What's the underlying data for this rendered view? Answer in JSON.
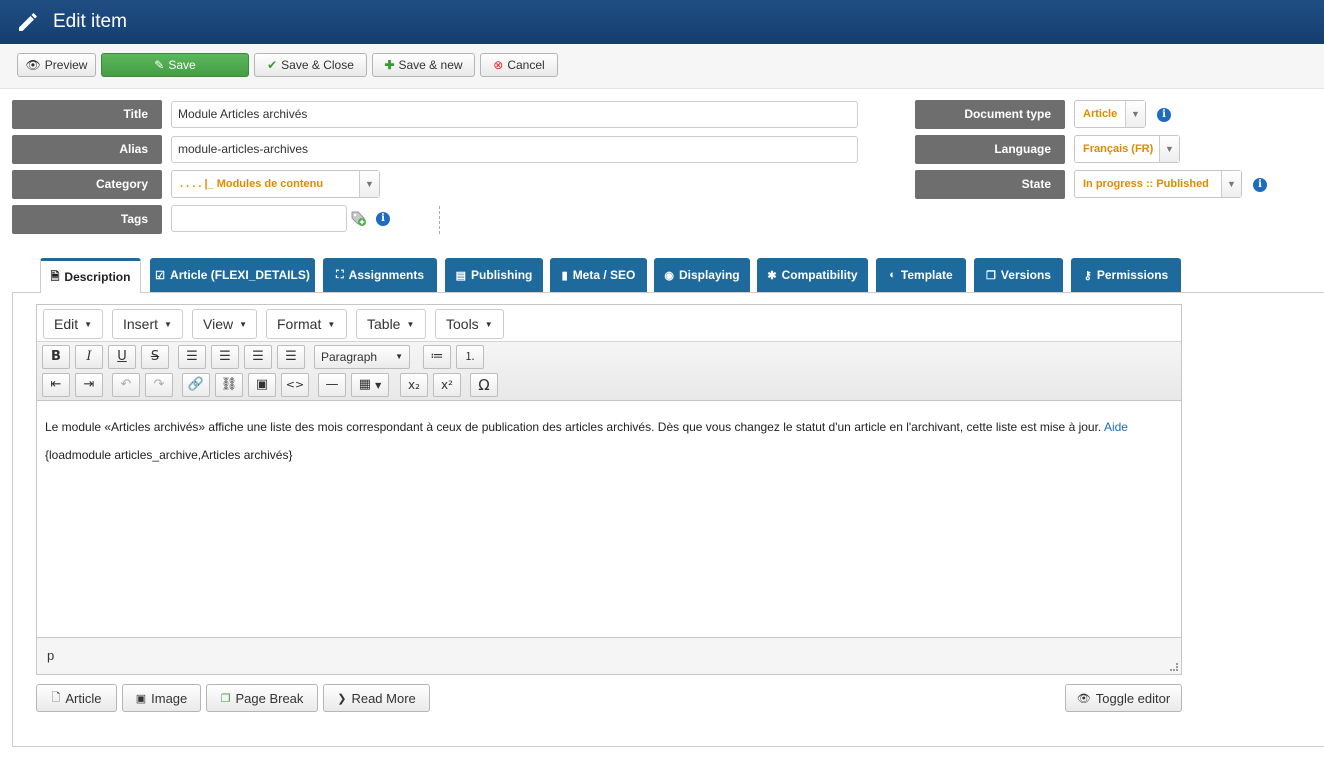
{
  "header": {
    "title": "Edit item"
  },
  "toolbar": {
    "preview": "Preview",
    "save": "Save",
    "save_close": "Save & Close",
    "save_new": "Save & new",
    "cancel": "Cancel"
  },
  "form": {
    "title_label": "Title",
    "title_value": "Module Articles archivés",
    "alias_label": "Alias",
    "alias_value": "module-articles-archives",
    "category_label": "Category",
    "category_value": ". . . .  |_ Modules de contenu",
    "tags_label": "Tags",
    "doctype_label": "Document type",
    "doctype_value": "Article",
    "language_label": "Language",
    "language_value": "Français (FR)",
    "state_label": "State",
    "state_value": "In progress :: Published",
    "info_glyph": "i"
  },
  "tabs": [
    {
      "label": "Description",
      "icon": "doc-icon",
      "glyph": "🗎"
    },
    {
      "label": "Article (FLEXI_DETAILS)",
      "icon": "checkbox-icon",
      "glyph": "☑"
    },
    {
      "label": "Assignments",
      "icon": "sitemap-icon",
      "glyph": "⛶"
    },
    {
      "label": "Publishing",
      "icon": "list-icon",
      "glyph": "▤"
    },
    {
      "label": "Meta / SEO",
      "icon": "bookmark-icon",
      "glyph": "▮"
    },
    {
      "label": "Displaying",
      "icon": "eye-icon",
      "glyph": "◉"
    },
    {
      "label": "Compatibility",
      "icon": "puzzle-icon",
      "glyph": "✱"
    },
    {
      "label": "Template",
      "icon": "palette-icon",
      "glyph": "◐"
    },
    {
      "label": "Versions",
      "icon": "copy-icon",
      "glyph": "❐"
    },
    {
      "label": "Permissions",
      "icon": "key-icon",
      "glyph": "⚷"
    }
  ],
  "editor": {
    "menus": [
      "Edit",
      "Insert",
      "View",
      "Format",
      "Table",
      "Tools"
    ],
    "paragraph_select": "Paragraph",
    "content_line1": "Le module «Articles archivés» affiche une liste des mois correspondant à ceux de publication des articles archivés. Dès que vous changez le statut d'un article en l'archivant, cette liste est mise à jour.",
    "content_link": "Aide",
    "content_line2": "{loadmodule articles_archive,Articles archivés}",
    "status_path": "p"
  },
  "bottom_buttons": {
    "article": "Article",
    "image": "Image",
    "page_break": "Page Break",
    "read_more": "Read More",
    "toggle_editor": "Toggle editor"
  },
  "colors": {
    "header": "#1f4e84",
    "save_green": "#5cb85c",
    "tab_blue": "#1e6a9c",
    "select_orange": "#e08a00",
    "label_gray": "#6e6e6e"
  }
}
